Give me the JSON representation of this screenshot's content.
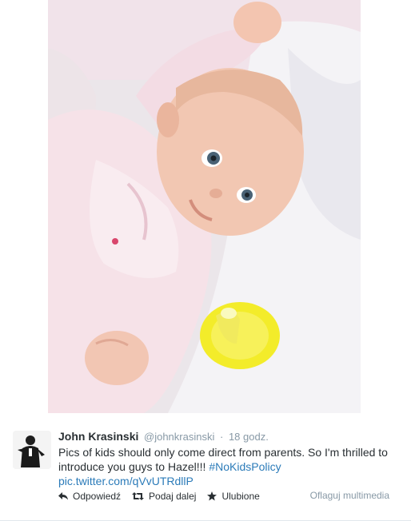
{
  "tweet": {
    "fullname": "John Krasinski",
    "username": "@johnkrasinski",
    "separator": "·",
    "time": "18 godz.",
    "text": "Pics of kids should only come direct from parents. So I'm thrilled to introduce you guys to Hazel!!! ",
    "hashtag": "#NoKidsPolicy",
    "link": "pic.twitter.com/qVvUTRdllP"
  },
  "actions": {
    "reply": "Odpowiedź",
    "retweet": "Podaj dalej",
    "favorite": "Ulubione",
    "flag": "Oflaguj multimedia"
  },
  "icons": {
    "reply": "reply-icon",
    "retweet": "retweet-icon",
    "favorite": "star-icon",
    "avatar": "avatar"
  },
  "colors": {
    "link": "#2b7bb9",
    "secondary": "#8899a6",
    "text": "#292f33"
  }
}
